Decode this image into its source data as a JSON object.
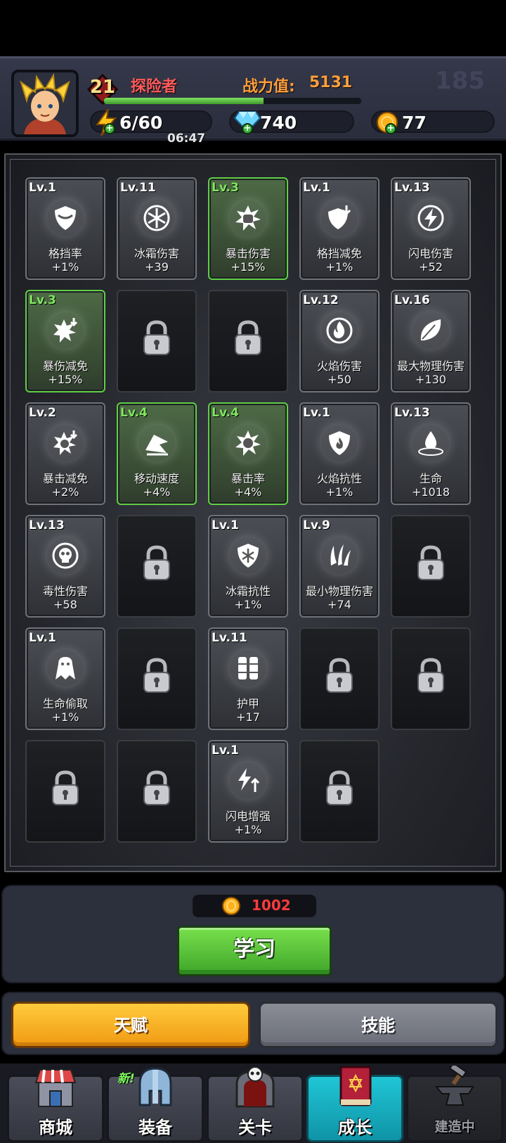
{
  "header": {
    "level": "21",
    "title": "探险者",
    "power_label": "战力值:",
    "power_value": "5131",
    "xp_progress": 0.62,
    "ghost_number": "185",
    "energy": "6/60",
    "energy_timer": "06:47",
    "gems": "740",
    "coins": "77"
  },
  "talents": [
    {
      "level": "Lv.1",
      "name": "格挡率",
      "bonus": "+1%",
      "state": "normal",
      "icon": "shield-icon"
    },
    {
      "level": "Lv.11",
      "name": "冰霜伤害",
      "bonus": "+39",
      "state": "normal",
      "icon": "snowflake-icon"
    },
    {
      "level": "Lv.3",
      "name": "暴击伤害",
      "bonus": "+15%",
      "state": "green",
      "icon": "fist-burst-icon"
    },
    {
      "level": "Lv.1",
      "name": "格挡减免",
      "bonus": "+1%",
      "state": "normal",
      "icon": "shield-down-icon"
    },
    {
      "level": "Lv.13",
      "name": "闪电伤害",
      "bonus": "+52",
      "state": "normal",
      "icon": "lightning-icon"
    },
    {
      "level": "Lv.3",
      "name": "暴伤减免",
      "bonus": "+15%",
      "state": "green",
      "icon": "fist-burst-down-icon"
    },
    {
      "state": "locked"
    },
    {
      "state": "locked"
    },
    {
      "level": "Lv.12",
      "name": "火焰伤害",
      "bonus": "+50",
      "state": "normal",
      "icon": "flame-icon"
    },
    {
      "level": "Lv.16",
      "name": "最大物理伤害",
      "bonus": "+130",
      "state": "normal",
      "icon": "leaf-icon"
    },
    {
      "level": "Lv.2",
      "name": "暴击减免",
      "bonus": "+2%",
      "state": "normal",
      "icon": "burst-down-icon"
    },
    {
      "level": "Lv.4",
      "name": "移动速度",
      "bonus": "+4%",
      "state": "green",
      "icon": "wind-icon"
    },
    {
      "level": "Lv.4",
      "name": "暴击率",
      "bonus": "+4%",
      "state": "green",
      "icon": "burst-icon"
    },
    {
      "level": "Lv.1",
      "name": "火焰抗性",
      "bonus": "+1%",
      "state": "normal",
      "icon": "fire-shield-icon"
    },
    {
      "level": "Lv.13",
      "name": "生命",
      "bonus": "+1018",
      "state": "normal",
      "icon": "drop-icon"
    },
    {
      "level": "Lv.13",
      "name": "毒性伤害",
      "bonus": "+58",
      "state": "normal",
      "icon": "skull-icon"
    },
    {
      "state": "locked"
    },
    {
      "level": "Lv.1",
      "name": "冰霜抗性",
      "bonus": "+1%",
      "state": "normal",
      "icon": "frost-shield-icon"
    },
    {
      "level": "Lv.9",
      "name": "最小物理伤害",
      "bonus": "+74",
      "state": "normal",
      "icon": "claw-icon"
    },
    {
      "state": "locked"
    },
    {
      "level": "Lv.1",
      "name": "生命偷取",
      "bonus": "+1%",
      "state": "normal",
      "icon": "vampire-icon"
    },
    {
      "state": "locked"
    },
    {
      "level": "Lv.11",
      "name": "护甲",
      "bonus": "+17",
      "state": "normal",
      "icon": "armor-icon"
    },
    {
      "state": "locked"
    },
    {
      "state": "locked"
    },
    {
      "state": "locked"
    },
    {
      "state": "locked"
    },
    {
      "level": "Lv.1",
      "name": "闪电增强",
      "bonus": "+1%",
      "state": "normal",
      "icon": "lightning-up-icon"
    },
    {
      "state": "locked"
    }
  ],
  "learn": {
    "cost": "1002",
    "button_label": "学习"
  },
  "tabs": {
    "talent_label": "天赋",
    "skill_label": "技能"
  },
  "nav": {
    "shop": "商城",
    "equipment": "装备",
    "new_badge": "新!",
    "stages": "关卡",
    "growth": "成长",
    "building": "建造中"
  },
  "colors": {
    "accent_green": "#5fcf45",
    "title_red": "#ff5a5a",
    "power_orange": "#ff9e3d",
    "cost_red": "#ff3b3b",
    "active_tab": "#f5a623",
    "active_nav": "#1bb3c4"
  }
}
